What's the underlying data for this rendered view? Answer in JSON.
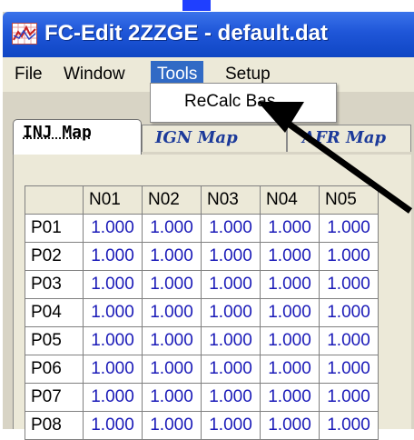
{
  "window": {
    "title": "FC-Edit 2ZZGE - default.dat",
    "icon": "chart-line-icon"
  },
  "menu": {
    "items": [
      "File",
      "Window",
      "Tools",
      "Setup"
    ],
    "active": "Tools",
    "dropdown": {
      "item": "ReCalc Bas"
    }
  },
  "tabs": {
    "selected": "INJ Map",
    "others": [
      "IGN Map",
      "AFR Map"
    ]
  },
  "grid": {
    "columns": [
      "N01",
      "N02",
      "N03",
      "N04",
      "N05"
    ],
    "rows": [
      {
        "label": "P01",
        "values": [
          "1.000",
          "1.000",
          "1.000",
          "1.000",
          "1.000"
        ]
      },
      {
        "label": "P02",
        "values": [
          "1.000",
          "1.000",
          "1.000",
          "1.000",
          "1.000"
        ]
      },
      {
        "label": "P03",
        "values": [
          "1.000",
          "1.000",
          "1.000",
          "1.000",
          "1.000"
        ]
      },
      {
        "label": "P04",
        "values": [
          "1.000",
          "1.000",
          "1.000",
          "1.000",
          "1.000"
        ]
      },
      {
        "label": "P05",
        "values": [
          "1.000",
          "1.000",
          "1.000",
          "1.000",
          "1.000"
        ]
      },
      {
        "label": "P06",
        "values": [
          "1.000",
          "1.000",
          "1.000",
          "1.000",
          "1.000"
        ]
      },
      {
        "label": "P07",
        "values": [
          "1.000",
          "1.000",
          "1.000",
          "1.000",
          "1.000"
        ]
      },
      {
        "label": "P08",
        "values": [
          "1.000",
          "1.000",
          "1.000",
          "1.000",
          "1.000"
        ]
      }
    ]
  },
  "colors": {
    "titlebar": "#1f56d8",
    "menu_highlight": "#316ac5",
    "cell_text": "#1a1ab8",
    "window_bg": "#ece9d8"
  }
}
